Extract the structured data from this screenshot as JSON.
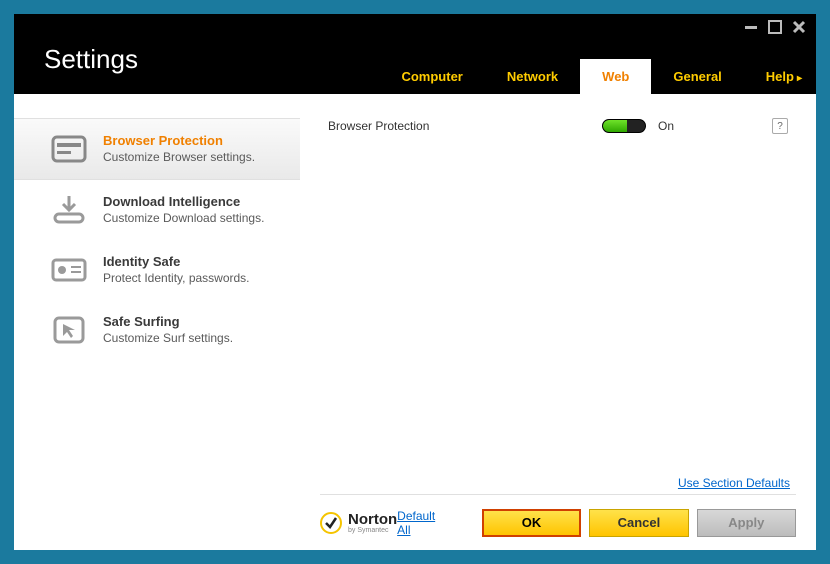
{
  "window": {
    "title": "Settings"
  },
  "tabs": [
    {
      "label": "Computer"
    },
    {
      "label": "Network"
    },
    {
      "label": "Web"
    },
    {
      "label": "General"
    },
    {
      "label": "Help"
    }
  ],
  "help_arrow": "▸",
  "sidebar": {
    "items": [
      {
        "title": "Browser Protection",
        "desc": "Customize Browser settings."
      },
      {
        "title": "Download Intelligence",
        "desc": "Customize Download settings."
      },
      {
        "title": "Identity Safe",
        "desc": "Protect Identity, passwords."
      },
      {
        "title": "Safe Surfing",
        "desc": "Customize Surf settings."
      }
    ]
  },
  "content": {
    "setting_label": "Browser Protection",
    "toggle_state": "On",
    "help_symbol": "?",
    "section_defaults": "Use Section Defaults"
  },
  "footer": {
    "brand": "Norton",
    "brand_sub": "by Symantec",
    "default_all": "Default All",
    "ok": "OK",
    "cancel": "Cancel",
    "apply": "Apply"
  }
}
